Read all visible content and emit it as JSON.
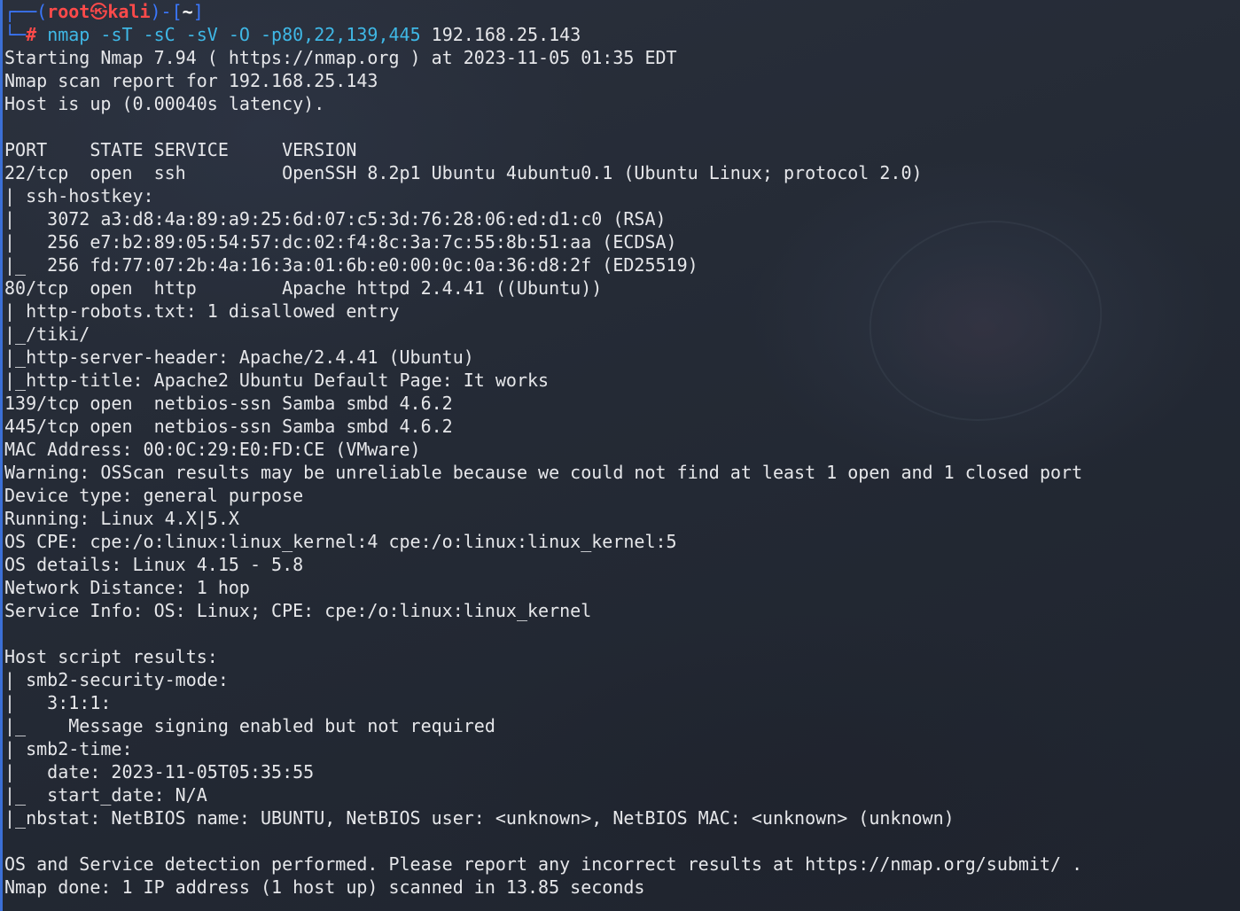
{
  "prompt": {
    "open_corner": "┌──(",
    "user": "root",
    "skull": "㉿",
    "host": "kali",
    "mid": ")-[",
    "dir": "~",
    "close": "]",
    "cmd_corner": "└─",
    "hash": "# ",
    "command": "nmap",
    "args": " -sT -sC -sV -O -p80,22,139,445 ",
    "target": "192.168.25.143"
  },
  "output": [
    "Starting Nmap 7.94 ( https://nmap.org ) at 2023-11-05 01:35 EDT",
    "Nmap scan report for 192.168.25.143",
    "Host is up (0.00040s latency).",
    "",
    "PORT    STATE SERVICE     VERSION",
    "22/tcp  open  ssh         OpenSSH 8.2p1 Ubuntu 4ubuntu0.1 (Ubuntu Linux; protocol 2.0)",
    "| ssh-hostkey: ",
    "|   3072 a3:d8:4a:89:a9:25:6d:07:c5:3d:76:28:06:ed:d1:c0 (RSA)",
    "|   256 e7:b2:89:05:54:57:dc:02:f4:8c:3a:7c:55:8b:51:aa (ECDSA)",
    "|_  256 fd:77:07:2b:4a:16:3a:01:6b:e0:00:0c:0a:36:d8:2f (ED25519)",
    "80/tcp  open  http        Apache httpd 2.4.41 ((Ubuntu))",
    "| http-robots.txt: 1 disallowed entry ",
    "|_/tiki/",
    "|_http-server-header: Apache/2.4.41 (Ubuntu)",
    "|_http-title: Apache2 Ubuntu Default Page: It works",
    "139/tcp open  netbios-ssn Samba smbd 4.6.2",
    "445/tcp open  netbios-ssn Samba smbd 4.6.2",
    "MAC Address: 00:0C:29:E0:FD:CE (VMware)",
    "Warning: OSScan results may be unreliable because we could not find at least 1 open and 1 closed port",
    "Device type: general purpose",
    "Running: Linux 4.X|5.X",
    "OS CPE: cpe:/o:linux:linux_kernel:4 cpe:/o:linux:linux_kernel:5",
    "OS details: Linux 4.15 - 5.8",
    "Network Distance: 1 hop",
    "Service Info: OS: Linux; CPE: cpe:/o:linux:linux_kernel",
    "",
    "Host script results:",
    "| smb2-security-mode: ",
    "|   3:1:1: ",
    "|_    Message signing enabled but not required",
    "| smb2-time: ",
    "|   date: 2023-11-05T05:35:55",
    "|_  start_date: N/A",
    "|_nbstat: NetBIOS name: UBUNTU, NetBIOS user: <unknown>, NetBIOS MAC: <unknown> (unknown)",
    "",
    "OS and Service detection performed. Please report any incorrect results at https://nmap.org/submit/ .",
    "Nmap done: 1 IP address (1 host up) scanned in 13.85 seconds"
  ]
}
